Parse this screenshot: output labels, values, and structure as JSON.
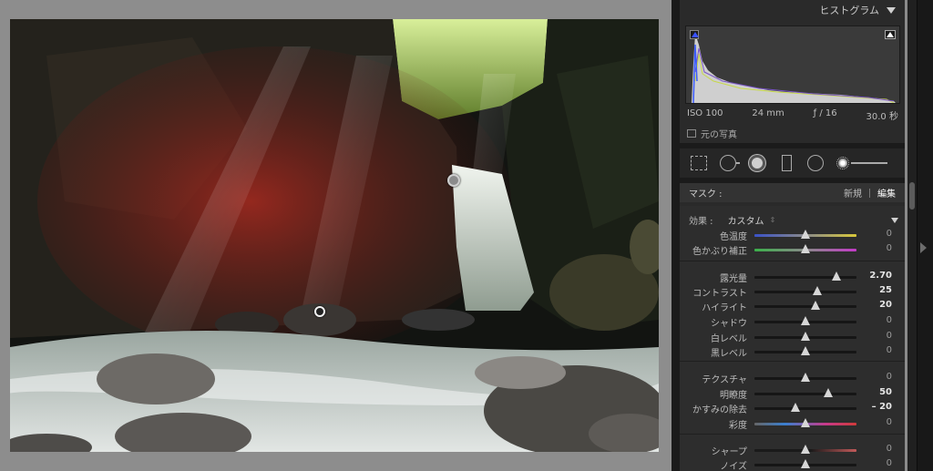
{
  "photo": {
    "description_colors": {
      "shadow": "#0f120f",
      "red_mask": "#9a2a22",
      "foliage": "#a7c65b"
    }
  },
  "panel": {
    "histogram": {
      "title": "ヒストグラム",
      "iso": "ISO 100",
      "focal": "24 mm",
      "aperture": "ƒ / 16",
      "shutter": "30.0 秒",
      "original_label": "元の写真"
    },
    "mask": {
      "label": "マスク :",
      "new_label": "新規",
      "edit_label": "編集"
    },
    "effect": {
      "label": "効果 :",
      "value": "カスタム"
    },
    "sliders": [
      {
        "name": "temperature",
        "label": "色温度",
        "value": "0",
        "pos": 0.5,
        "track": "temp"
      },
      {
        "name": "tint",
        "label": "色かぶり補正",
        "value": "0",
        "pos": 0.5,
        "track": "tint"
      },
      {
        "name": "exposure",
        "label": "露光量",
        "value": "2.70",
        "pos": 0.8,
        "bold": true
      },
      {
        "name": "contrast",
        "label": "コントラスト",
        "value": "25",
        "pos": 0.62,
        "bold": true
      },
      {
        "name": "highlights",
        "label": "ハイライト",
        "value": "20",
        "pos": 0.6,
        "bold": true
      },
      {
        "name": "shadows",
        "label": "シャドウ",
        "value": "0",
        "pos": 0.5
      },
      {
        "name": "whites",
        "label": "白レベル",
        "value": "0",
        "pos": 0.5
      },
      {
        "name": "blacks",
        "label": "黒レベル",
        "value": "0",
        "pos": 0.5
      },
      {
        "name": "texture",
        "label": "テクスチャ",
        "value": "0",
        "pos": 0.5
      },
      {
        "name": "clarity",
        "label": "明瞭度",
        "value": "50",
        "pos": 0.72,
        "bold": true
      },
      {
        "name": "dehaze",
        "label": "かすみの除去",
        "value": "– 20",
        "pos": 0.4,
        "bold": true
      },
      {
        "name": "saturation",
        "label": "彩度",
        "value": "0",
        "pos": 0.5,
        "track": "sat"
      },
      {
        "name": "sharpness",
        "label": "シャープ",
        "value": "0",
        "pos": 0.5,
        "track": "sharp"
      },
      {
        "name": "noise",
        "label": "ノイズ",
        "value": "0",
        "pos": 0.5
      }
    ]
  }
}
